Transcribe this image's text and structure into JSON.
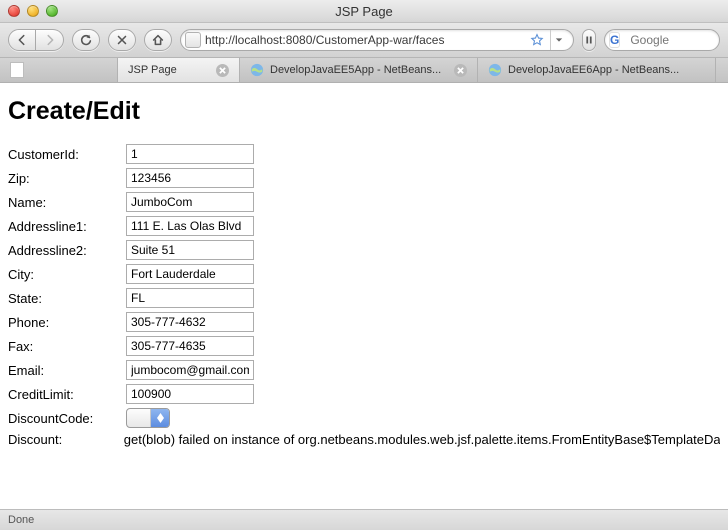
{
  "window": {
    "title": "JSP Page"
  },
  "toolbar": {
    "url": "http://localhost:8080/CustomerApp-war/faces",
    "search_placeholder": "Google"
  },
  "tabs": [
    {
      "label": "",
      "kind": "blank",
      "closable": false
    },
    {
      "label": "JSP Page",
      "kind": "jsp",
      "closable": true,
      "active": true
    },
    {
      "label": "DevelopJavaEE5App - NetBeans...",
      "kind": "nb",
      "closable": true
    },
    {
      "label": "DevelopJavaEE6App - NetBeans...",
      "kind": "nb",
      "closable": false
    }
  ],
  "page": {
    "heading": "Create/Edit",
    "fields": [
      {
        "label": "CustomerId:",
        "value": "1"
      },
      {
        "label": "Zip:",
        "value": "123456"
      },
      {
        "label": "Name:",
        "value": "JumboCom"
      },
      {
        "label": "Addressline1:",
        "value": "111 E. Las Olas Blvd"
      },
      {
        "label": "Addressline2:",
        "value": "Suite 51"
      },
      {
        "label": "City:",
        "value": "Fort Lauderdale"
      },
      {
        "label": "State:",
        "value": "FL"
      },
      {
        "label": "Phone:",
        "value": "305-777-4632"
      },
      {
        "label": "Fax:",
        "value": "305-777-4635"
      },
      {
        "label": "Email:",
        "value": "jumbocom@gmail.com"
      },
      {
        "label": "CreditLimit:",
        "value": "100900"
      }
    ],
    "discount_code_label": "DiscountCode:",
    "discount_label": "Discount:",
    "discount_message": "get(blob) failed on instance of org.netbeans.modules.web.jsf.palette.items.FromEntityBase$TemplateData"
  },
  "status": {
    "text": "Done"
  }
}
